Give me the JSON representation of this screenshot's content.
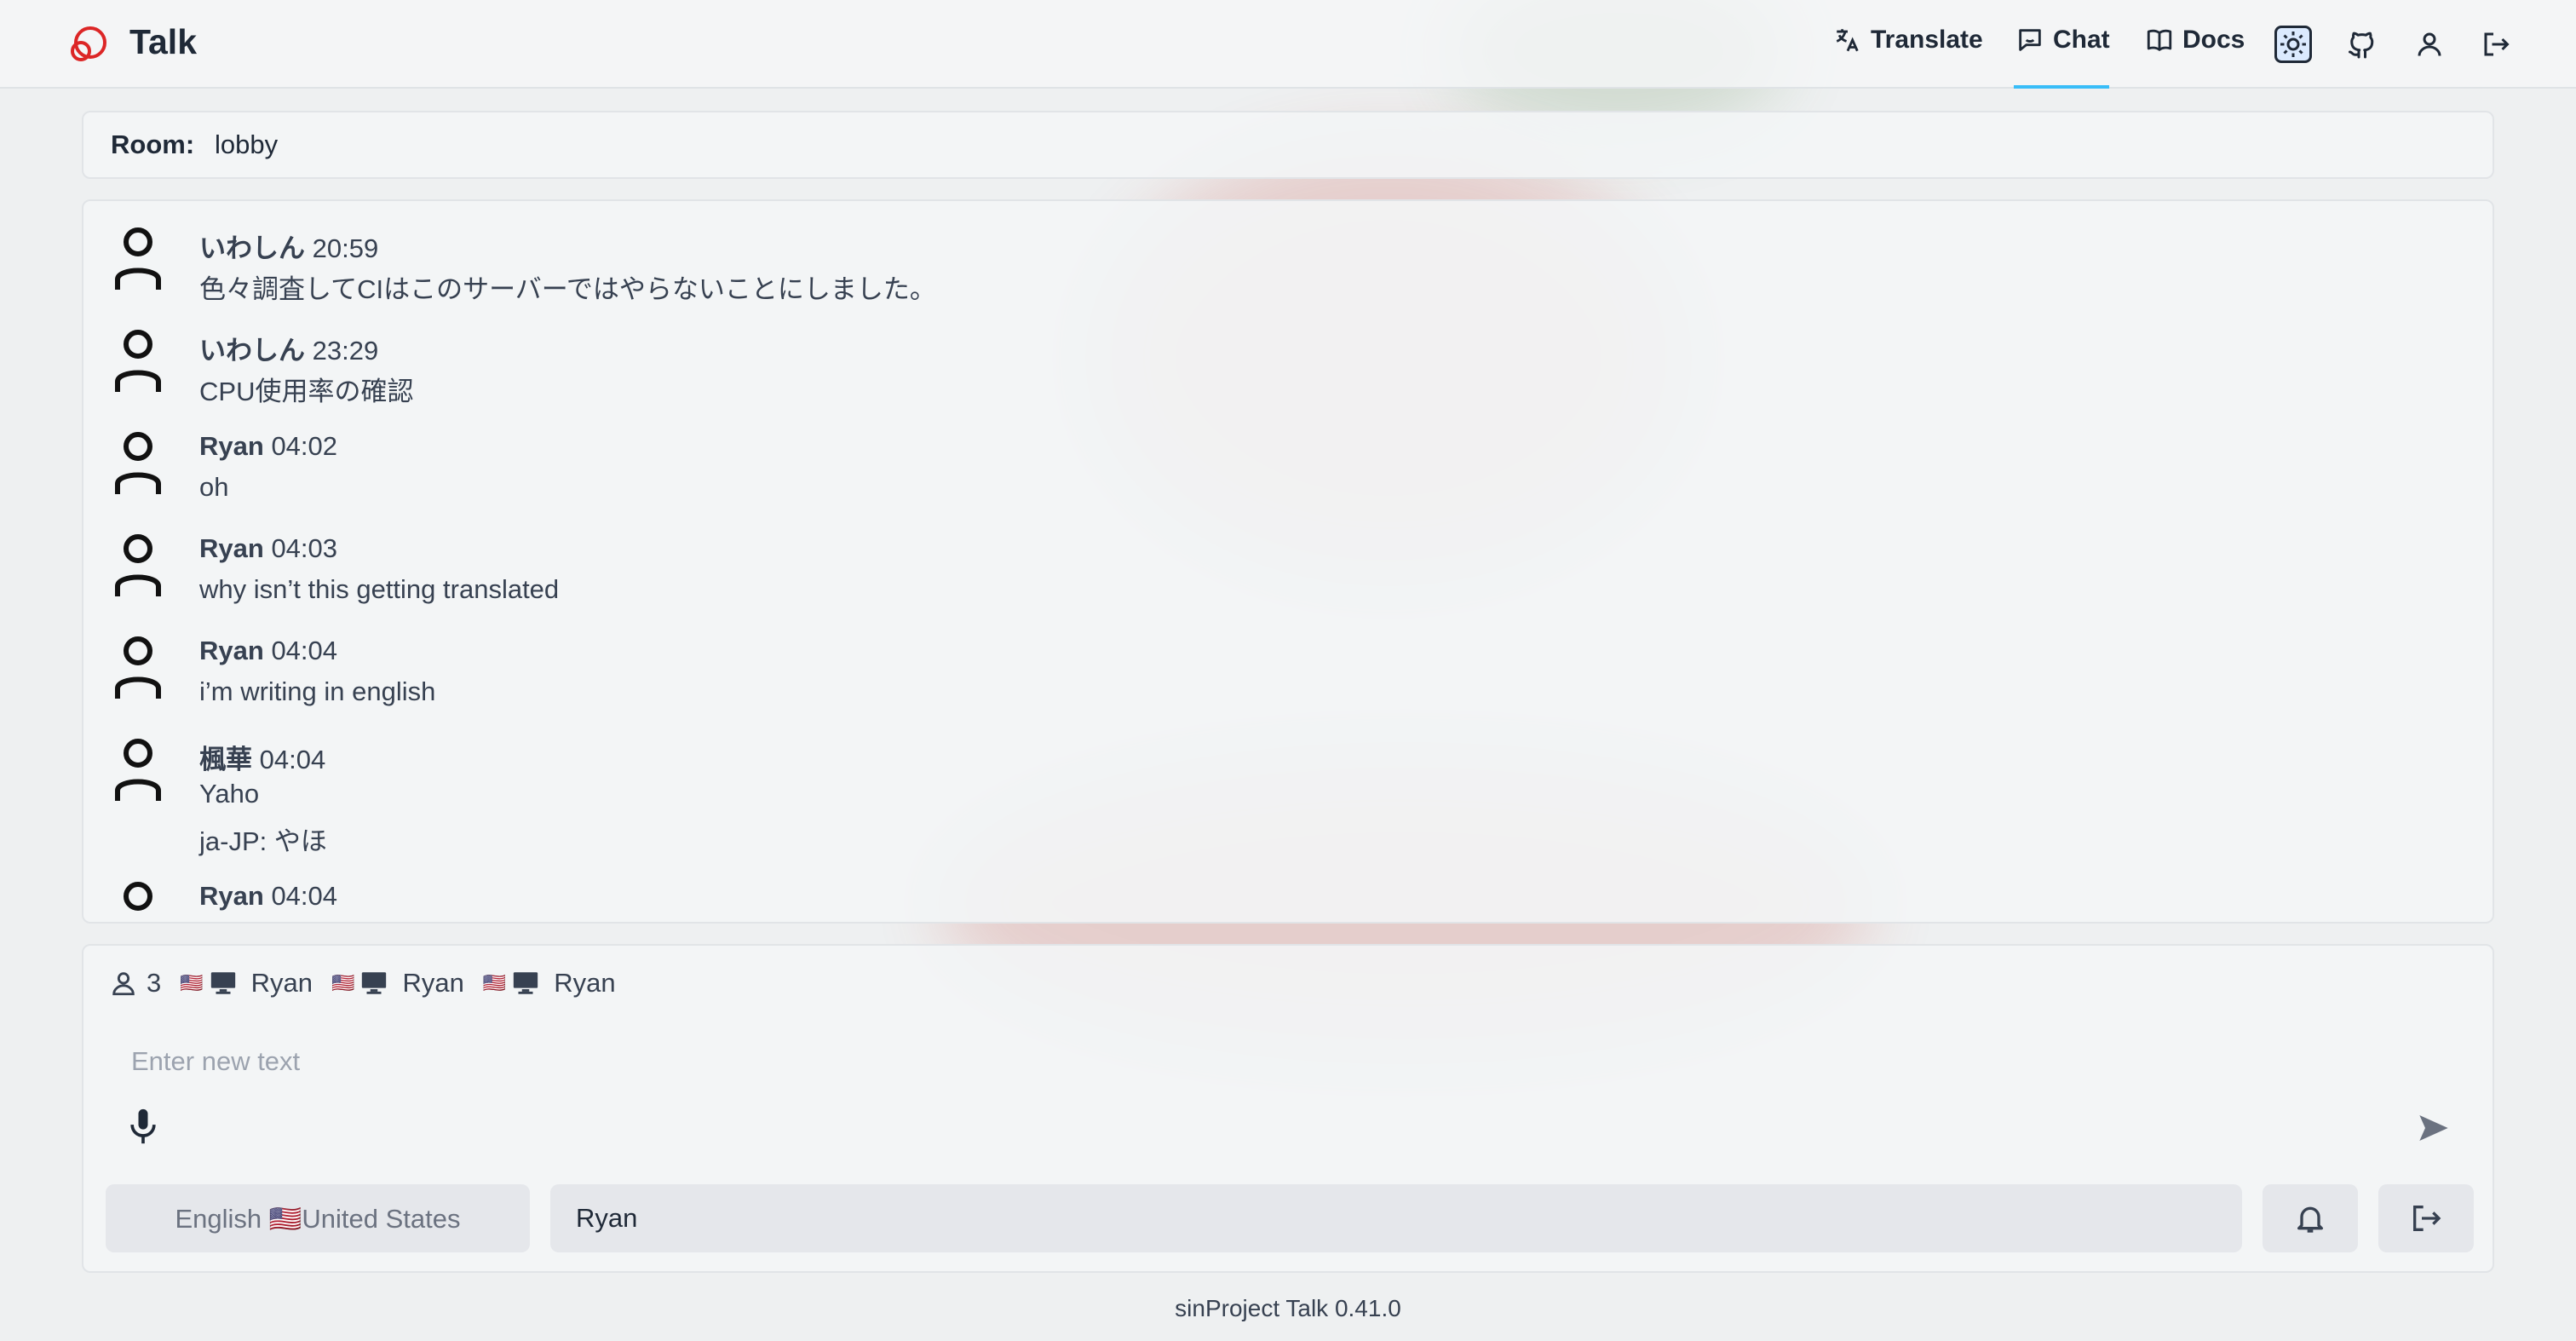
{
  "app": {
    "brand": "Talk"
  },
  "nav": {
    "translate": "Translate",
    "chat": "Chat",
    "docs": "Docs"
  },
  "room": {
    "label": "Room:",
    "value": "lobby"
  },
  "messages": [
    {
      "user": "いわしん",
      "time": "20:59",
      "lines": [
        "色々調査してCIはこのサーバーではやらないことにしました。"
      ]
    },
    {
      "user": "いわしん",
      "time": "23:29",
      "lines": [
        "CPU使用率の確認"
      ]
    },
    {
      "user": "Ryan",
      "time": "04:02",
      "lines": [
        "oh"
      ]
    },
    {
      "user": "Ryan",
      "time": "04:03",
      "lines": [
        "why isn’t this getting translated"
      ]
    },
    {
      "user": "Ryan",
      "time": "04:04",
      "lines": [
        "i’m writing in english"
      ]
    },
    {
      "user": "楓華",
      "time": "04:04",
      "lines": [
        "Yaho",
        "ja-JP: やほ"
      ]
    },
    {
      "user": "Ryan",
      "time": "04:04",
      "lines": []
    }
  ],
  "online": {
    "count": "3",
    "users": [
      {
        "flag": "🇺🇸",
        "name": "Ryan"
      },
      {
        "flag": "🇺🇸",
        "name": "Ryan"
      },
      {
        "flag": "🇺🇸",
        "name": "Ryan"
      }
    ]
  },
  "composer": {
    "placeholder": "Enter new text",
    "language": "English 🇺🇸United States",
    "name": "Ryan"
  },
  "footer": "sinProject Talk 0.41.0",
  "colors": {
    "accent": "#38bdf8",
    "logo": "#dc2626"
  }
}
